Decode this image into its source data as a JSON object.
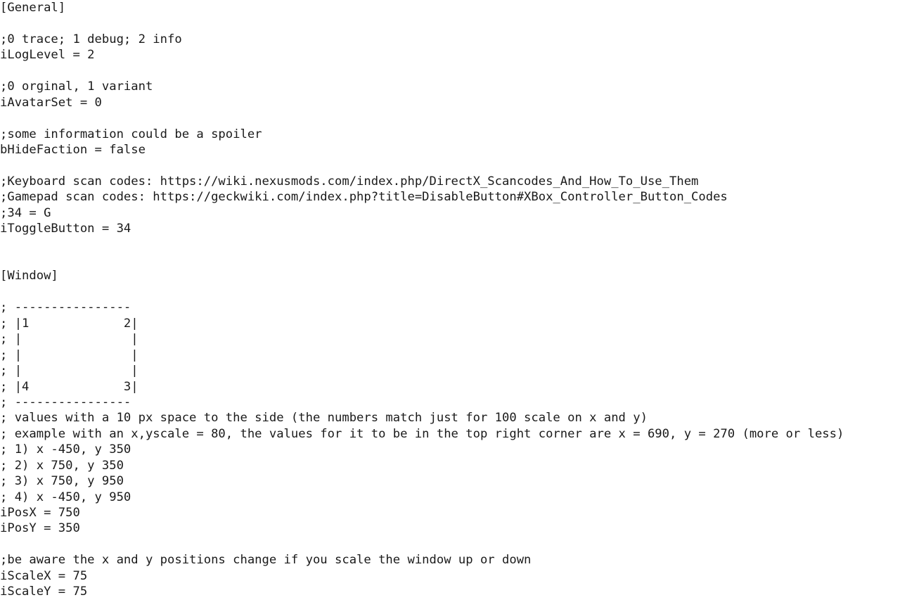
{
  "document": {
    "kind": "ini-config-text",
    "font_size_px": 17,
    "line_height_px": 22,
    "text_color": "#1a1a1a",
    "background_color": "#ffffff",
    "sections": [
      "[General]",
      "[Window]"
    ],
    "lines": [
      "[General]",
      "",
      ";0 trace; 1 debug; 2 info",
      "iLogLevel = 2",
      "",
      ";0 orginal, 1 variant",
      "iAvatarSet = 0",
      "",
      ";some information could be a spoiler",
      "bHideFaction = false",
      "",
      ";Keyboard scan codes: https://wiki.nexusmods.com/index.php/DirectX_Scancodes_And_How_To_Use_Them",
      ";Gamepad scan codes: https://geckwiki.com/index.php?title=DisableButton#XBox_Controller_Button_Codes",
      ";34 = G",
      "iToggleButton = 34",
      "",
      "",
      "[Window]",
      "",
      "; ----------------",
      "; |1             2|",
      "; |               |",
      "; |               |",
      "; |               |",
      "; |4             3|",
      "; ----------------",
      "; values with a 10 px space to the side (the numbers match just for 100 scale on x and y)",
      "; example with an x,yscale = 80, the values for it to be in the top right corner are x = 690, y = 270 (more or less)",
      "; 1) x -450, y 350",
      "; 2) x 750, y 350",
      "; 3) x 750, y 950",
      "; 4) x -450, y 950",
      "iPosX = 750",
      "iPosY = 350",
      "",
      ";be aware the x and y positions change if you scale the window up or down",
      "iScaleX = 75",
      "iScaleY = 75"
    ],
    "settings": [
      {
        "key": "iLogLevel",
        "value": "2",
        "comment": ";0 trace; 1 debug; 2 info",
        "section": "[General]"
      },
      {
        "key": "iAvatarSet",
        "value": "0",
        "comment": ";0 orginal, 1 variant",
        "section": "[General]"
      },
      {
        "key": "bHideFaction",
        "value": "false",
        "comment": ";some information could be a spoiler",
        "section": "[General]"
      },
      {
        "key": "iToggleButton",
        "value": "34",
        "comment": ";34 = G",
        "section": "[General]"
      },
      {
        "key": "iPosX",
        "value": "750",
        "comment": "",
        "section": "[Window]"
      },
      {
        "key": "iPosY",
        "value": "350",
        "comment": "",
        "section": "[Window]"
      },
      {
        "key": "iScaleX",
        "value": "75",
        "comment": ";be aware the x and y positions change if you scale the window up or down",
        "section": "[Window]"
      },
      {
        "key": "iScaleY",
        "value": "75",
        "comment": "",
        "section": "[Window]"
      }
    ],
    "reference_urls": [
      "https://wiki.nexusmods.com/index.php/DirectX_Scancodes_And_How_To_Use_Them",
      "https://geckwiki.com/index.php?title=DisableButton#XBox_Controller_Button_Codes"
    ],
    "corner_coordinates": [
      {
        "corner": "1",
        "x": "-450",
        "y": "350"
      },
      {
        "corner": "2",
        "x": "750",
        "y": "350"
      },
      {
        "corner": "3",
        "x": "750",
        "y": "950"
      },
      {
        "corner": "4",
        "x": "-450",
        "y": "950"
      }
    ]
  }
}
